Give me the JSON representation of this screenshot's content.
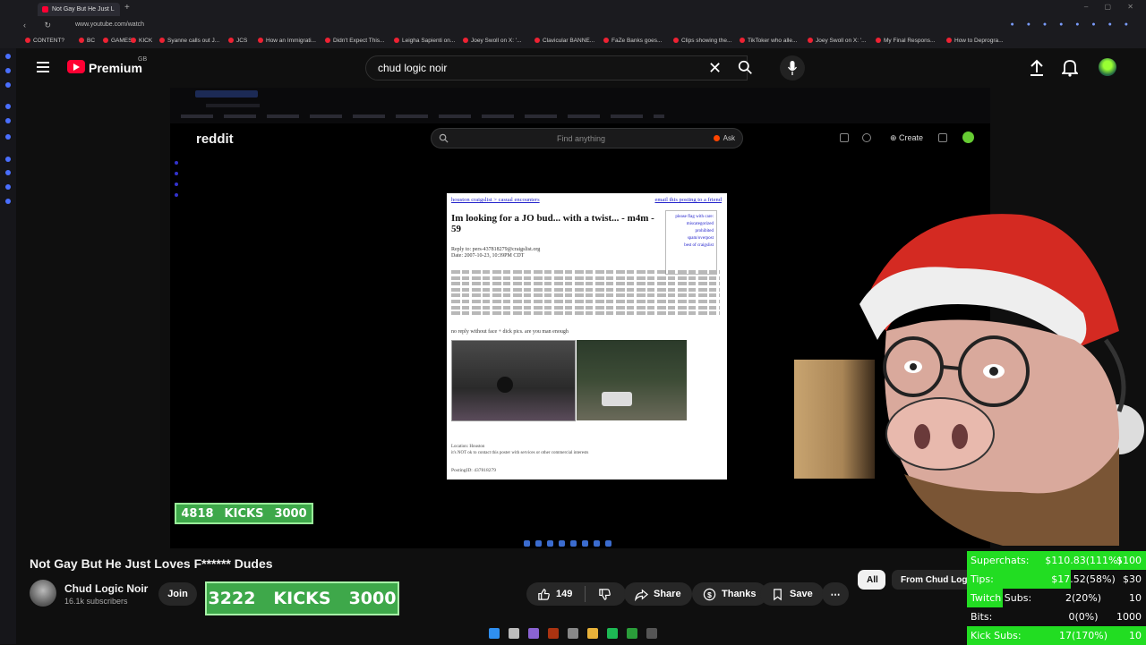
{
  "browser": {
    "tab_title": "Not Gay But He Just L",
    "url": "www.youtube.com/watch",
    "bookmarks": [
      "CONTENT?",
      "BC",
      "GAMES",
      "KICK",
      "Syanne calls out J...",
      "JCS",
      "How an Immigrati...",
      "Didn't Expect This...",
      "Leigha Sapienti on...",
      "Joey Swoll on X: '...",
      "Clavicular BANNE...",
      "FaZe Banks goes...",
      "Clips showing the...",
      "TikToker who alle...",
      "Joey Swoll on X: '...",
      "My Final Respons...",
      "How to Deprogra..."
    ]
  },
  "header": {
    "brand": "Premium",
    "region": "GB",
    "search_value": "chud logic noir"
  },
  "player": {
    "reddit": {
      "logo": "reddit",
      "search_placeholder": "Find anything",
      "ask_label": "Ask",
      "create_label": "Create"
    },
    "post": {
      "breadcrumb": "houston craigslist > casual encounters",
      "email_link": "email this posting to a friend",
      "title": "Im looking for a JO bud... with a twist... - m4m - 59",
      "reply_line": "Reply to: pers-437818279@craigslist.org",
      "date_line": "Date: 2007-10-23, 10:39PM CDT",
      "box_links": [
        "please flag with care:",
        "miscategorized",
        "prohibited",
        "spam/overpost",
        "best of craigslist"
      ],
      "no_reply": "no reply without face + dick pics. are you man enough",
      "location": "Location: Houston",
      "not_ok": "it's NOT ok to contact this poster with services or other commercial interests",
      "posting_id": "PostingID: 437818279"
    },
    "kicks_small": {
      "current": "4818",
      "label": "KICKS",
      "goal": "3000"
    }
  },
  "video": {
    "title": "Not Gay But He Just Loves F****** Dudes",
    "channel_name": "Chud Logic Noir",
    "subscribers": "16.1k subscribers",
    "join_label": "Join",
    "likes": "149",
    "share_label": "Share",
    "thanks_label": "Thanks",
    "save_label": "Save",
    "kicks_big": {
      "current": "3222",
      "label": "KICKS",
      "goal": "3000"
    }
  },
  "chips": {
    "all": "All",
    "from": "From Chud Logi"
  },
  "stats": [
    {
      "label": "Superchats:",
      "value": "$110.83(111%)",
      "goal": "$100",
      "fill": 1.0
    },
    {
      "label": "Tips:",
      "value": "$17.52(58%)",
      "goal": "$30",
      "fill": 0.58
    },
    {
      "label": "Twitch Subs:",
      "value": "2(20%)",
      "goal": "10",
      "fill": 0.2
    },
    {
      "label": "Bits:",
      "value": "0(0%)",
      "goal": "1000",
      "fill": 0.0
    },
    {
      "label": "Kick Subs:",
      "value": "17(170%)",
      "goal": "10",
      "fill": 1.0
    }
  ],
  "colors": {
    "youtube_red": "#ff0033",
    "kicks_green": "#3ea84a",
    "stat_green": "#22dd22",
    "reddit_orange": "#ff4500"
  }
}
